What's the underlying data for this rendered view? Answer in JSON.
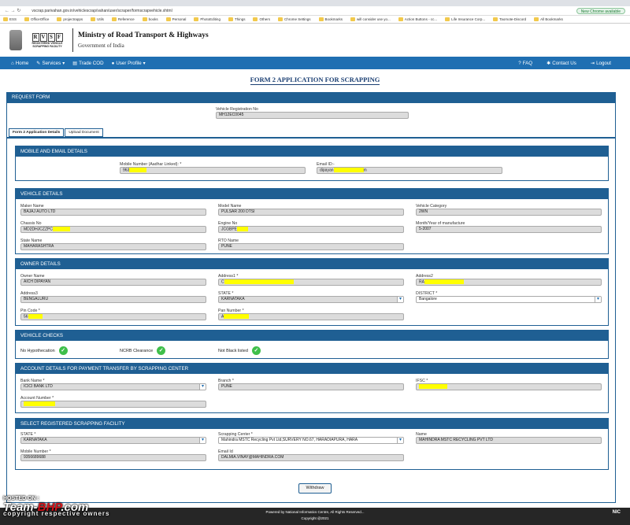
{
  "browser": {
    "url": "vscrap.parivahan.gov.in/vehiclescrap/vahan/user/scraper/formscrapvehicle.xhtml",
    "new_chrome": "New Chrome available",
    "bookmarks": [
      "ESS",
      "OfficeOffice",
      "projectrapps",
      "Utils",
      "Reference",
      "books",
      "Personal",
      "PhotoEditing",
      "Things",
      "Others",
      "Chrome Settings",
      "Bookmarks",
      "will consider use yo...",
      "Action Buttons - cc...",
      "Life Insurance Corp...",
      "Taomote-Discord",
      "All Bookmarks"
    ]
  },
  "header": {
    "logo_letters": [
      "R",
      "V",
      "S",
      "F"
    ],
    "logo_sub1": "REGISTERED VEHICLE",
    "logo_sub2": "SCRAPPING FACILITY",
    "ministry": "Ministry of Road Transport & Highways",
    "government": "Government of India"
  },
  "nav": {
    "home": "Home",
    "services": "Services",
    "trade_cod": "Trade COD",
    "user_profile": "User Profile",
    "faq": "FAQ",
    "contact": "Contact Us",
    "logout": "Logout"
  },
  "form_title": "FORM 2 APPLICATION FOR SCRAPPING",
  "request": {
    "title": "REQUEST FORM",
    "reg_label": "Vehicle Registration No",
    "reg_value": "MH12EC0045"
  },
  "tabs": [
    "Form 2 Application Details",
    "Upload Document"
  ],
  "mobile": {
    "title": "MOBILE AND EMAIL DETAILS",
    "mobile_label": "Mobile Number (Aadhar Linked): *",
    "mobile_value": "963",
    "email_label": "Email ID:-",
    "email_value": "dipayan",
    "email_suffix": "m"
  },
  "vehicle": {
    "title": "VEHICLE DETAILS",
    "maker_label": "Maker Name",
    "maker": "BAJAJ AUTO LTD",
    "model_label": "Model Name",
    "model": "PULSAR 200 DTSI",
    "category_label": "Vehicle Category",
    "category": "2WN",
    "chassis_label": "Chassis No",
    "chassis": "MD2DHJCZZPC",
    "engine_label": "Engine No",
    "engine": "JCGBPE",
    "month_label": "Month/Year of manufacture",
    "month": "5-2007",
    "state_label": "State Name",
    "state": "MAHARASHTRA",
    "rto_label": "RTO Name",
    "rto": "PUNE"
  },
  "owner": {
    "title": "OWNER DETAILS",
    "name_label": "Owner Name",
    "name": "AICH DIPAYAN",
    "addr1_label": "Address1 *",
    "addr1": "C",
    "addr2_label": "Address2",
    "addr2": "RA",
    "addr3_label": "Address3",
    "addr3": "BENGALURU",
    "state_label": "STATE *",
    "state": "KARNATAKA",
    "district_label": "DISTRICT *",
    "district": "Bangalore",
    "pin_label": "Pin Code *",
    "pin": "56",
    "pan_label": "Pan Number *",
    "pan": "A"
  },
  "checks": {
    "title": "VEHICLE CHECKS",
    "items": [
      "No Hypothecation",
      "NCRB Clearance",
      "Not Black listed"
    ]
  },
  "account": {
    "title": "ACCOUNT DETAILS FOR PAYMENT TRANSFER BY SCRAPPING CENTER",
    "bank_label": "Bank Name *",
    "bank": "ICICI BANK LTD",
    "branch_label": "Branch *",
    "branch": "PUNE",
    "ifsc_label": "IFSC *",
    "acct_label": "Account Number *"
  },
  "facility": {
    "title": "SELECT REGISTERED SCRAPPING FACILITY",
    "state_label": "STATE *",
    "state": "KARNATAKA",
    "center_label": "Scrapping Center *",
    "center": "Mahindra MSTC Recycling Pvt Ltd,SURVERY NO.67, HARADIAPURA, HARA",
    "name_label": "Name",
    "name": "MAHINDRA MSTC RECYCLING PVT LTD",
    "mobile_label": "Mobile Number *",
    "mobile": "9356689688",
    "email_label": "Email Id",
    "email": "DALMIA.VINAY@MAHINDRA.COM"
  },
  "withdraw": "Withdraw",
  "footer": {
    "powered": "Powered by National Informatics Centre, All Rights Reserved...",
    "copyright": "Copyright @2021",
    "nic": "NIC"
  },
  "watermark": {
    "hosted": "HOSTED ON :",
    "brand1": "Team-",
    "brand2": "BHP",
    "brand3": ".com",
    "tag": "copyright respective owners"
  }
}
